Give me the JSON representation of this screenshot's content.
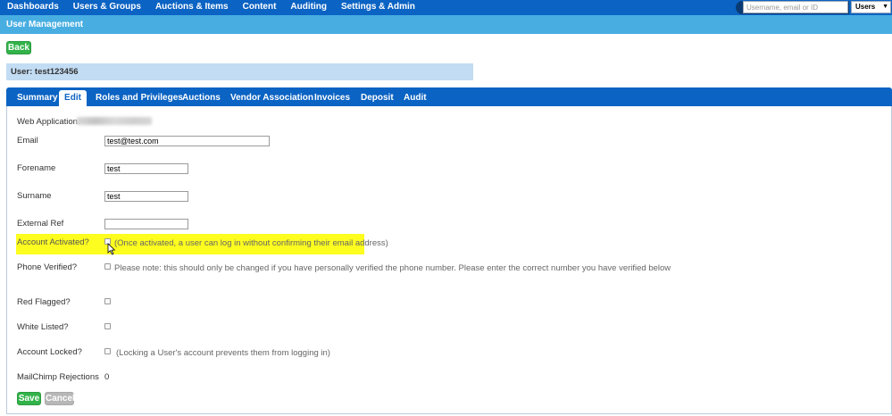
{
  "topnav": {
    "items": [
      "Dashboards",
      "Users & Groups",
      "Auctions & Items",
      "Content",
      "Auditing",
      "Settings & Admin"
    ],
    "search_placeholder": "Username, email or ID",
    "search_scope": "Users"
  },
  "section_title": "User Management",
  "back_label": "Back",
  "user_bar": "User: test123456",
  "tabs": [
    "Summary",
    "Edit",
    "Roles and Privileges",
    "Auctions",
    "Vendor Association",
    "Invoices",
    "Deposit",
    "Audit"
  ],
  "active_tab": "Edit",
  "form": {
    "web_application_label": "Web Application:",
    "email_label": "Email",
    "email_value": "test@test.com",
    "forename_label": "Forename",
    "forename_value": "test",
    "surname_label": "Surname",
    "surname_value": "test",
    "external_ref_label": "External Ref",
    "external_ref_value": "",
    "account_activated_label": "Account Activated?",
    "account_activated_note": "(Once activated, a user can log in without confirming their email address)",
    "phone_verified_label": "Phone Verified?",
    "phone_verified_note": "Please note: this should only be changed if you have personally verified the phone number. Please enter the correct number you have verified below",
    "red_flagged_label": "Red Flagged?",
    "white_listed_label": "White Listed?",
    "account_locked_label": "Account Locked?",
    "account_locked_note": "(Locking a User's account prevents them from logging in)",
    "mailchimp_label": "MailChimp Rejections",
    "mailchimp_value": "0"
  },
  "save_label": "Save",
  "cancel_label": "Cancel",
  "colors": {
    "nav_blue": "#0b63c3",
    "section_blue": "#48aee2",
    "button_green": "#32b34a",
    "highlight_yellow": "#fdfd1f"
  }
}
